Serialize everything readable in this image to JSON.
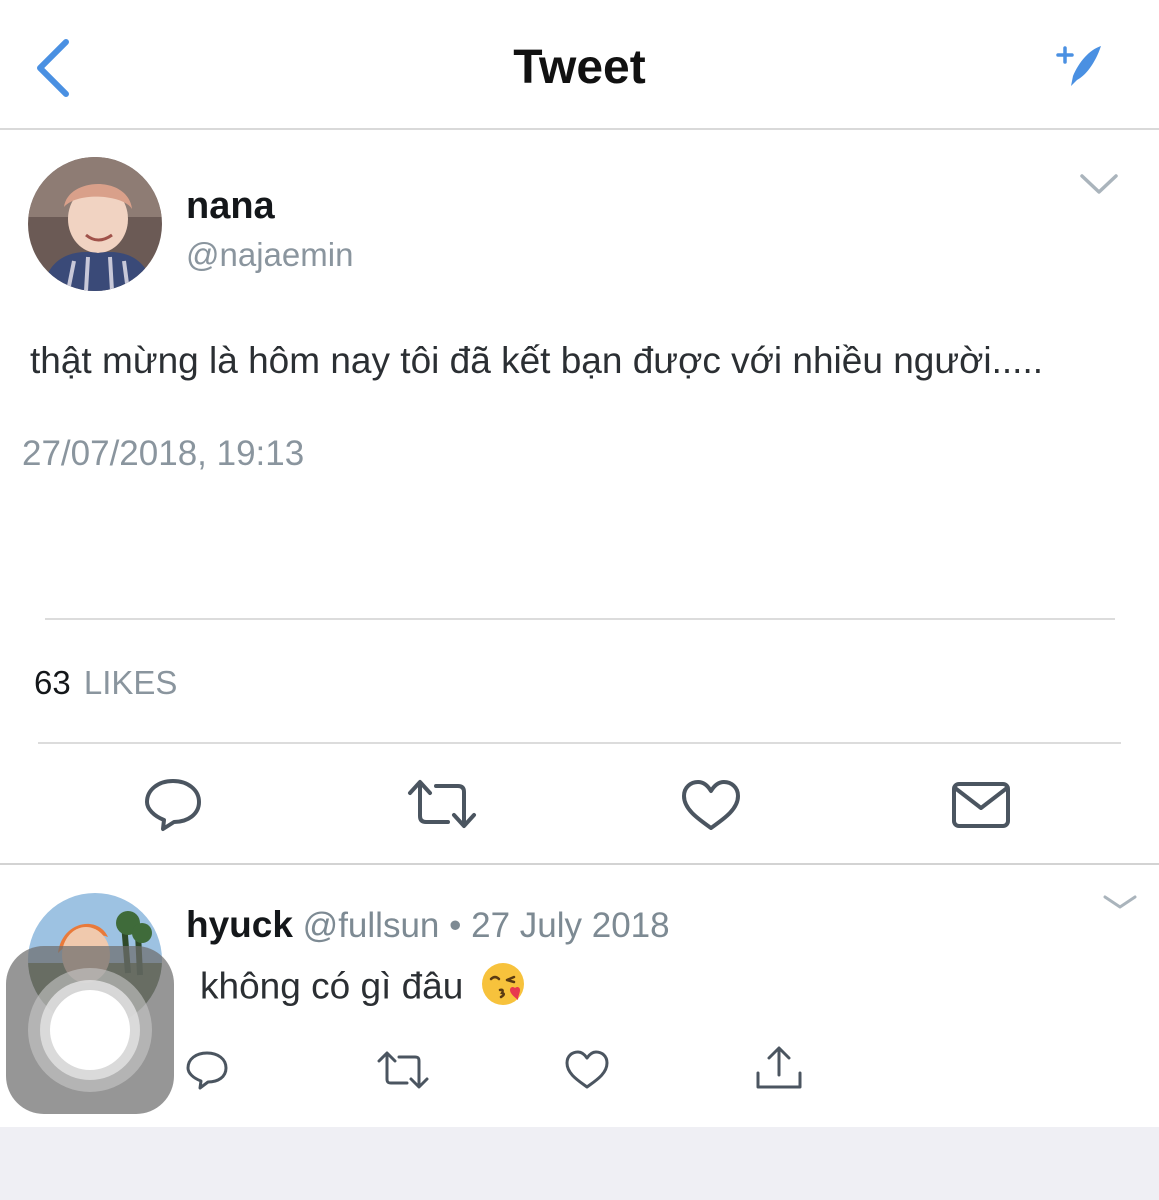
{
  "header": {
    "title": "Tweet",
    "back_icon": "chevron-left-icon",
    "compose_icon": "compose-sparkle-icon",
    "accent_color": "#4a90e2"
  },
  "tweet": {
    "display_name": "nana",
    "handle": "@najaemin",
    "text": "thật mừng là hôm nay tôi đã kết bạn được với nhiều người.....",
    "timestamp": "27/07/2018, 19:13",
    "likes_count": "63",
    "likes_label": "LIKES",
    "actions": [
      "reply-icon",
      "retweet-icon",
      "like-icon",
      "direct-message-icon"
    ]
  },
  "reply": {
    "display_name": "hyuck",
    "handle": "@fullsun",
    "separator": "•",
    "date": "27 July 2018",
    "text": "không có gì đâu",
    "emoji": "😘",
    "actions": [
      "reply-icon",
      "retweet-icon",
      "like-icon",
      "share-icon"
    ]
  }
}
